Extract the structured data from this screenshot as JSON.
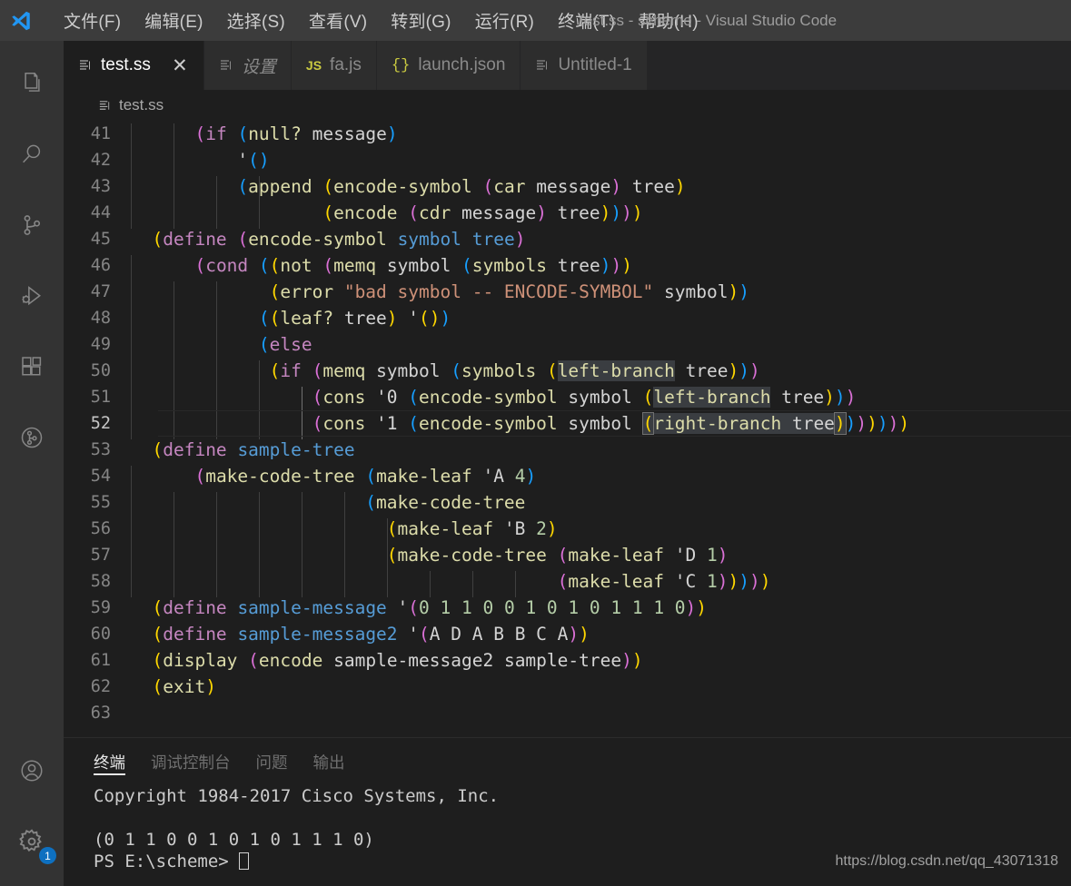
{
  "titlebar": {
    "window_title": "test.ss - scheme - Visual Studio Code",
    "logo_icon": "vscode-logo-icon",
    "menus": [
      {
        "label": "文件(F)"
      },
      {
        "label": "编辑(E)"
      },
      {
        "label": "选择(S)"
      },
      {
        "label": "查看(V)"
      },
      {
        "label": "转到(G)"
      },
      {
        "label": "运行(R)"
      },
      {
        "label": "终端(T)"
      },
      {
        "label": "帮助(H)"
      }
    ]
  },
  "activitybar": {
    "top": [
      {
        "name": "explorer-icon",
        "title": "资源管理器"
      },
      {
        "name": "search-icon",
        "title": "搜索"
      },
      {
        "name": "source-control-icon",
        "title": "源代码管理"
      },
      {
        "name": "run-debug-icon",
        "title": "运行和调试"
      },
      {
        "name": "extensions-icon",
        "title": "扩展"
      },
      {
        "name": "git-graph-icon",
        "title": "Git Graph"
      }
    ],
    "bottom": [
      {
        "name": "account-icon",
        "title": "帐户"
      },
      {
        "name": "settings-gear-icon",
        "title": "管理",
        "badge": "1"
      }
    ]
  },
  "tabs": [
    {
      "label": "test.ss",
      "icon": "scheme-file-icon",
      "active": true,
      "italic": false,
      "close": "✕"
    },
    {
      "label": "设置",
      "icon": "settings-file-icon",
      "active": false,
      "italic": true
    },
    {
      "label": "fa.js",
      "icon": "js-file-icon",
      "active": false,
      "italic": false
    },
    {
      "label": "launch.json",
      "icon": "json-file-icon",
      "active": false,
      "italic": false
    },
    {
      "label": "Untitled-1",
      "icon": "plain-file-icon",
      "active": false,
      "italic": false
    }
  ],
  "breadcrumb": {
    "icon": "scheme-file-icon",
    "label": "test.ss"
  },
  "editor": {
    "language": "scheme",
    "current_line": 52,
    "first_visible_line": 41,
    "last_visible_line": 63,
    "lines": [
      {
        "n": "41",
        "text": "      (if (null? message)"
      },
      {
        "n": "42",
        "text": "          '()"
      },
      {
        "n": "43",
        "text": "          (append (encode-symbol (car message) tree)"
      },
      {
        "n": "44",
        "text": "                  (encode (cdr message) tree))))"
      },
      {
        "n": "45",
        "text": "  (define (encode-symbol symbol tree)"
      },
      {
        "n": "46",
        "text": "      (cond ((not (memq symbol (symbols tree)))"
      },
      {
        "n": "47",
        "text": "             (error \"bad symbol -- ENCODE-SYMBOL\" symbol))"
      },
      {
        "n": "48",
        "text": "            ((leaf? tree) '())"
      },
      {
        "n": "49",
        "text": "            (else"
      },
      {
        "n": "50",
        "text": "             (if (memq symbol (symbols (left-branch tree)))"
      },
      {
        "n": "51",
        "text": "                 (cons '0 (encode-symbol symbol (left-branch tree)))"
      },
      {
        "n": "52",
        "text": "                 (cons '1 (encode-symbol symbol (right-branch tree))))))))"
      },
      {
        "n": "53",
        "text": "  (define sample-tree"
      },
      {
        "n": "54",
        "text": "      (make-code-tree (make-leaf 'A 4)"
      },
      {
        "n": "55",
        "text": "                      (make-code-tree"
      },
      {
        "n": "56",
        "text": "                        (make-leaf 'B 2)"
      },
      {
        "n": "57",
        "text": "                        (make-code-tree (make-leaf 'D 1)"
      },
      {
        "n": "58",
        "text": "                                        (make-leaf 'C 1)))))"
      },
      {
        "n": "59",
        "text": "  (define sample-message '(0 1 1 0 0 1 0 1 0 1 1 1 0))"
      },
      {
        "n": "60",
        "text": "  (define sample-message2 '(A D A B B C A))"
      },
      {
        "n": "61",
        "text": "  (display (encode sample-message2 sample-tree))"
      },
      {
        "n": "62",
        "text": "  (exit)"
      },
      {
        "n": "63",
        "text": ""
      }
    ]
  },
  "panel": {
    "tabs": [
      {
        "label": "终端",
        "active": true
      },
      {
        "label": "调试控制台",
        "active": false
      },
      {
        "label": "问题",
        "active": false
      },
      {
        "label": "输出",
        "active": false
      }
    ],
    "terminal": {
      "lines": [
        "Copyright 1984-2017 Cisco Systems, Inc.",
        "",
        "(0 1 1 0 0 1 0 1 0 1 1 1 0)"
      ],
      "prompt": "PS E:\\scheme> "
    }
  },
  "watermark": "https://blog.csdn.net/qq_43071318",
  "colors": {
    "titlebar_bg": "#3c3c3c",
    "activitybar_bg": "#333333",
    "editor_bg": "#1e1e1e",
    "tabbar_bg": "#252526",
    "inactive_tab_bg": "#2d2d2d",
    "badge_bg": "#0e70c0",
    "keyword": "#c586c0",
    "function": "#dcdcaa",
    "variable": "#9cdcfe",
    "variable_blue": "#569cd6",
    "string": "#ce9178",
    "number": "#b5cea8",
    "text": "#d4d4d4",
    "line_number": "#858585"
  }
}
